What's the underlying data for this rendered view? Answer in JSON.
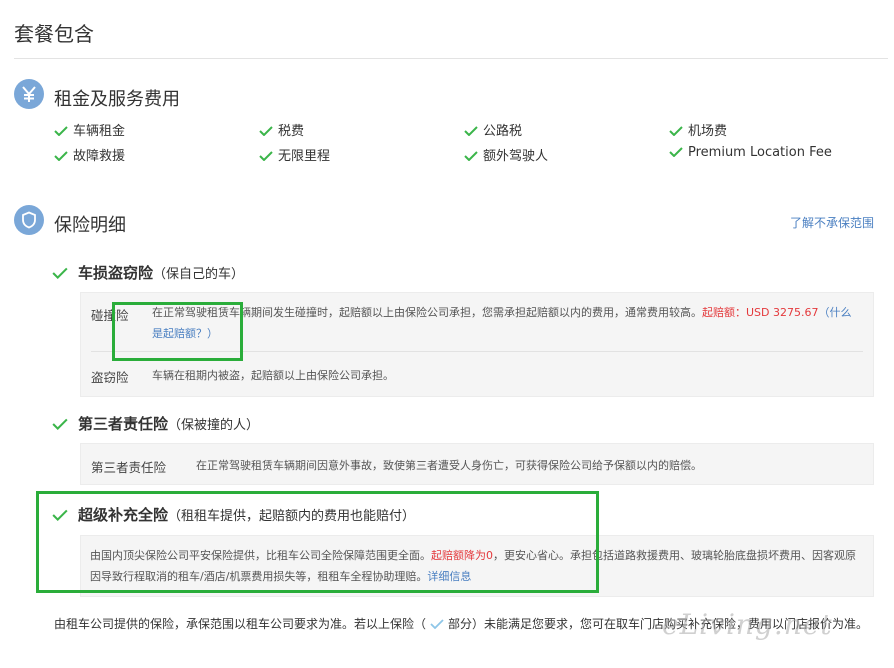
{
  "page": {
    "title": "套餐包含"
  },
  "rental": {
    "title": "租金及服务费用",
    "icon": "yen-icon",
    "items": [
      "车辆租金",
      "税费",
      "公路税",
      "机场费",
      "故障救援",
      "无限里程",
      "额外驾驶人",
      "Premium Location Fee"
    ]
  },
  "insurance": {
    "title": "保险明细",
    "icon": "shield-icon",
    "exclusions_link": "了解不承保范围",
    "coverages": [
      {
        "name": "车损盗窃险",
        "subtitle": "（保自己的车）",
        "rows": [
          {
            "label": "碰撞险",
            "desc_prefix": "在正常驾驶租赁车辆期间发生碰撞时，起赔额以上由保险公司承担，您需承担起赔额以内的费用，通常费用较高。",
            "highlight": "起赔额：USD 3275.67",
            "link": "（什么是起赔额？）"
          },
          {
            "label": "盗窃险",
            "desc": "车辆在租期内被盗，起赔额以上由保险公司承担。"
          }
        ]
      },
      {
        "name": "第三者责任险",
        "subtitle": "（保被撞的人）",
        "rows": [
          {
            "label": "第三者责任险",
            "desc": "在正常驾驶租赁车辆期间因意外事故，致使第三者遭受人身伤亡，可获得保险公司给予保额以内的赔偿。"
          }
        ]
      },
      {
        "name": "超级补充全险",
        "subtitle": "（租租车提供，起赔额内的费用也能赔付）",
        "desc_prefix": "由国内顶尖保险公司平安保险提供，比租车公司全险保障范围更全面。",
        "highlight": "起赔额降为0",
        "desc_suffix": "，更安心省心。承担包括道路救援费用、玻璃轮胎底盘损坏费用、因客观原因导致行程取消的租车/酒店/机票费用损失等，租租车全程协助理赔。",
        "link": "详细信息"
      }
    ]
  },
  "footer": {
    "text_before": "由租车公司提供的保险，承保范围以租车公司要求为准。若以上保险（",
    "text_partial": "部分",
    "text_after": "）未能满足您要求，您可在取车门店购买补充保险，费用以门店报价为准。"
  },
  "watermark": "eLiving.net",
  "colors": {
    "check": "#3bb54a",
    "icon_bg": "#7aa7d8",
    "link": "#4a7fc1",
    "highlight": "#e4393c",
    "annotation": "#2aad3a"
  }
}
